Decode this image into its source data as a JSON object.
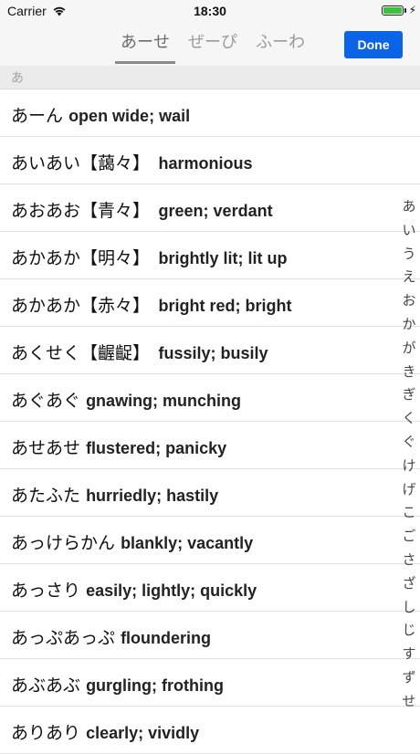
{
  "status_bar": {
    "carrier": "Carrier",
    "time": "18:30",
    "battery_level": 1.0,
    "battery_color": "#3ac23a"
  },
  "nav": {
    "tabs": [
      "あーせ",
      "ぜーぴ",
      "ふーわ"
    ],
    "active_tab": 0,
    "done_label": "Done",
    "accent_color": "#0b63e6"
  },
  "section_header": "あ",
  "entries": [
    {
      "reading": "あーん",
      "kanji": "",
      "gloss": "open wide; wail"
    },
    {
      "reading": "あいあい",
      "kanji": "【藹々】",
      "gloss": "harmonious"
    },
    {
      "reading": "あおあお",
      "kanji": "【青々】",
      "gloss": "green; verdant"
    },
    {
      "reading": "あかあか",
      "kanji": "【明々】",
      "gloss": "brightly lit; lit up"
    },
    {
      "reading": "あかあか",
      "kanji": "【赤々】",
      "gloss": "bright red; bright"
    },
    {
      "reading": "あくせく",
      "kanji": "【齷齪】",
      "gloss": "fussily; busily"
    },
    {
      "reading": "あぐあぐ",
      "kanji": "",
      "gloss": "gnawing; munching"
    },
    {
      "reading": "あせあせ",
      "kanji": "",
      "gloss": "flustered; panicky"
    },
    {
      "reading": "あたふた",
      "kanji": "",
      "gloss": "hurriedly; hastily"
    },
    {
      "reading": "あっけらかん",
      "kanji": "",
      "gloss": "blankly; vacantly"
    },
    {
      "reading": "あっさり",
      "kanji": "",
      "gloss": "easily; lightly; quickly"
    },
    {
      "reading": "あっぷあっぷ",
      "kanji": "",
      "gloss": "floundering"
    },
    {
      "reading": "あぶあぶ",
      "kanji": "",
      "gloss": "gurgling; frothing"
    },
    {
      "reading": "ありあり",
      "kanji": "",
      "gloss": "clearly; vividly"
    }
  ],
  "index": [
    "あ",
    "い",
    "う",
    "え",
    "お",
    "か",
    "が",
    "き",
    "ぎ",
    "く",
    "ぐ",
    "け",
    "げ",
    "こ",
    "ご",
    "さ",
    "ざ",
    "し",
    "じ",
    "す",
    "ず",
    "せ"
  ]
}
